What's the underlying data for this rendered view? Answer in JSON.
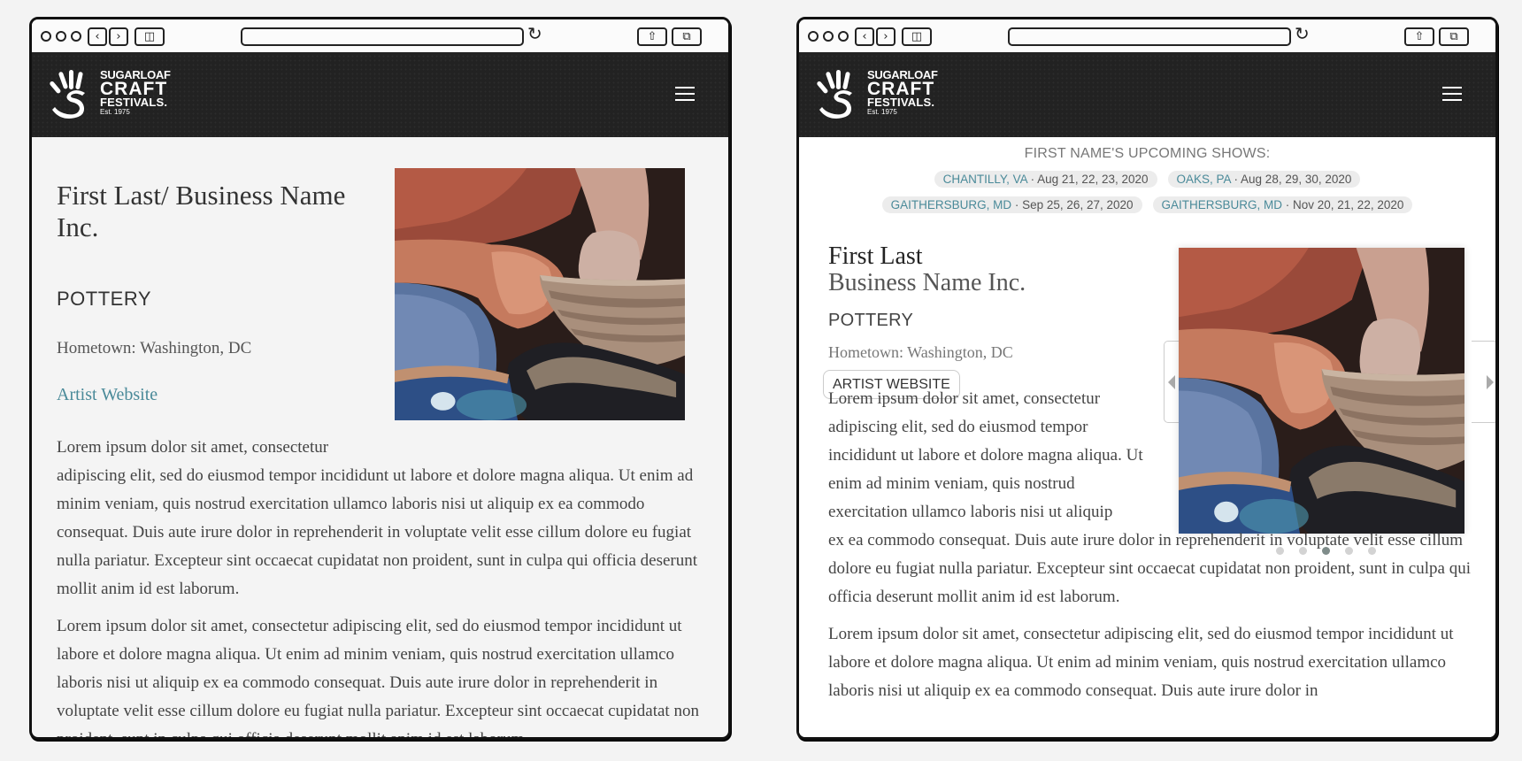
{
  "browser": {
    "back_icon": "‹",
    "forward_icon": "›",
    "sidebar_icon": "◫",
    "reload_icon": "↻",
    "share_icon": "⇧",
    "tabs_icon": "⧉"
  },
  "brand": {
    "line1": "SUGARLOAF",
    "line2": "CRAFT",
    "line3": "FESTIVALS.",
    "est": "Est. 1975",
    "header_bg": "#222222",
    "link_color": "#4a8a99"
  },
  "left": {
    "title": "First Last/ Business Name Inc.",
    "craft": "POTTERY",
    "hometown": "Hometown: Washington, DC",
    "website_link": "Artist Website",
    "para1_first": "Lorem ipsum dolor sit amet, consectetur",
    "para1_rest": "adipiscing elit, sed do eiusmod tempor  incididunt ut labore et dolore magna aliqua. Ut enim ad minim veniam, quis nostrud exercitation ullamco laboris nisi ut aliquip ex ea commodo consequat. Duis aute irure dolor in reprehenderit in voluptate velit esse cillum dolore eu fugiat nulla pariatur. Excepteur sint occaecat cupidatat non proident, sunt in culpa qui officia deserunt mollit anim id est laborum.",
    "para2": "Lorem ipsum dolor sit amet, consectetur adipiscing elit, sed do eiusmod tempor incididunt ut labore et dolore magna aliqua. Ut enim ad minim veniam, quis nostrud exercitation ullamco laboris nisi ut aliquip ex ea commodo consequat. Duis aute irure dolor in reprehenderit in voluptate velit esse cillum  dolore eu fugiat nulla pariatur. Excepteur sint occaecat cupidatat non proident, sunt in culpa qui officia deserunt mollit anim id est laborum."
  },
  "right": {
    "shows_title": "FIRST NAME'S UPCOMING SHOWS:",
    "shows": [
      {
        "city": "CHANTILLY, VA",
        "dates": " · Aug 21, 22, 23, 2020"
      },
      {
        "city": "OAKS, PA",
        "dates": " · Aug 28, 29, 30, 2020"
      },
      {
        "city": "GAITHERSBURG, MD",
        "dates": " · Sep 25, 26, 27, 2020"
      },
      {
        "city": "GAITHERSBURG, MD",
        "dates": " · Nov 20, 21, 22, 2020"
      }
    ],
    "name": "First Last",
    "business": "Business Name Inc.",
    "craft": "POTTERY",
    "hometown": "Hometown: Washington, DC",
    "website_button": "ARTIST WEBSITE",
    "carousel": {
      "total": 5,
      "active_index": 2
    },
    "para1_narrow": "Lorem ipsum dolor sit amet, consectetur adipiscing elit, sed do eiusmod tempor incididunt ut labore et dolore magna aliqua. Ut enim ad minim veniam, quis nostrud exercitation ullamco laboris nisi ut aliquip",
    "para1_wide": "ex ea commodo consequat. Duis aute irure dolor in reprehenderit in voluptate velit esse cillum dolore eu fugiat nulla pariatur. Excepteur sint occaecat cupidatat non proident, sunt in culpa qui officia deserunt mollit anim id est laborum.",
    "para2": "Lorem ipsum dolor sit amet, consectetur adipiscing elit, sed do eiusmod tempor incididunt ut labore et dolore magna aliqua. Ut enim ad minim veniam, quis nostrud exercitation ullamco laboris nisi ut aliquip ex ea commodo consequat. Duis aute irure dolor in"
  }
}
